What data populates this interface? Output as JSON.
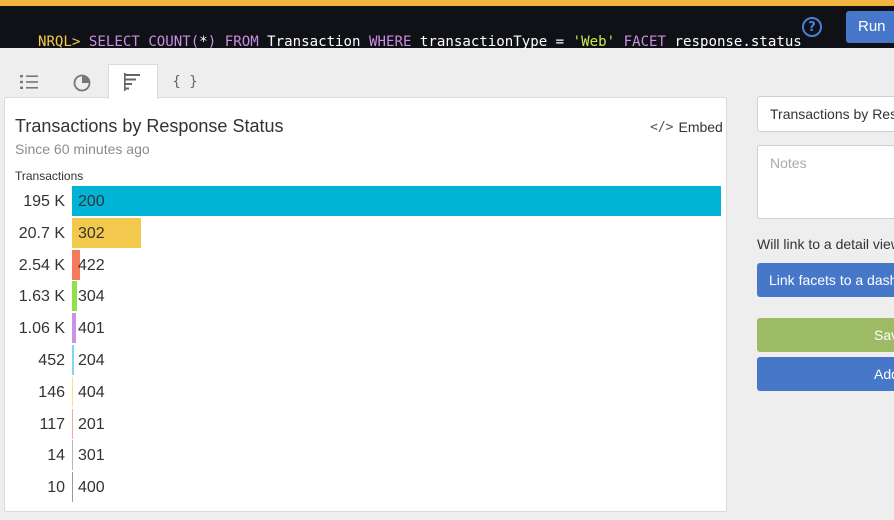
{
  "query": {
    "prompt": "NRQL>",
    "parts": [
      {
        "text": " ",
        "type": "txt"
      },
      {
        "text": "SELECT",
        "type": "kw"
      },
      {
        "text": " ",
        "type": "txt"
      },
      {
        "text": "COUNT(",
        "type": "kw"
      },
      {
        "text": "*",
        "type": "txt"
      },
      {
        "text": ")",
        "type": "kw"
      },
      {
        "text": " ",
        "type": "txt"
      },
      {
        "text": "FROM",
        "type": "kw"
      },
      {
        "text": " Transaction ",
        "type": "txt"
      },
      {
        "text": "WHERE",
        "type": "kw"
      },
      {
        "text": " transactionType = ",
        "type": "txt"
      },
      {
        "text": "'Web'",
        "type": "str"
      },
      {
        "text": " ",
        "type": "txt"
      },
      {
        "text": "FACET",
        "type": "kw"
      },
      {
        "text": " response.status",
        "type": "txt"
      }
    ],
    "help_label": "?",
    "run_label": "Run"
  },
  "tabs": [
    {
      "name": "list-icon",
      "active": false
    },
    {
      "name": "pie-chart-icon",
      "active": false
    },
    {
      "name": "bar-chart-icon",
      "active": true
    },
    {
      "name": "json-icon",
      "active": false
    }
  ],
  "json_tab_label": "{ }",
  "card": {
    "title": "Transactions by Response Status",
    "subtitle": "Since 60 minutes ago",
    "embed_label": "Embed",
    "embed_icon_label": "</>"
  },
  "chart_data": {
    "type": "bar",
    "orientation": "horizontal",
    "ylabel": "Transactions",
    "categories": [
      "200",
      "302",
      "422",
      "304",
      "401",
      "204",
      "404",
      "201",
      "301",
      "400"
    ],
    "value_labels": [
      "195 K",
      "20.7 K",
      "2.54 K",
      "1.63 K",
      "1.06 K",
      "452",
      "146",
      "117",
      "14",
      "10"
    ],
    "values": [
      195000,
      20700,
      2540,
      1630,
      1060,
      452,
      146,
      117,
      14,
      10
    ],
    "colors": [
      "#00b3d7",
      "#f2c94c",
      "#f57b5a",
      "#8ee04e",
      "#c993e6",
      "#7fd8ef",
      "#f4e58a",
      "#f5a7a7",
      "#b7b7b7",
      "#999999"
    ]
  },
  "sidebar": {
    "title_value": "Transactions by Resp",
    "notes_placeholder": "Notes",
    "detail_text": "Will link to a detail view",
    "link_button": "Link facets to a dashboard",
    "save_button": "Save",
    "add_button": "Add"
  }
}
